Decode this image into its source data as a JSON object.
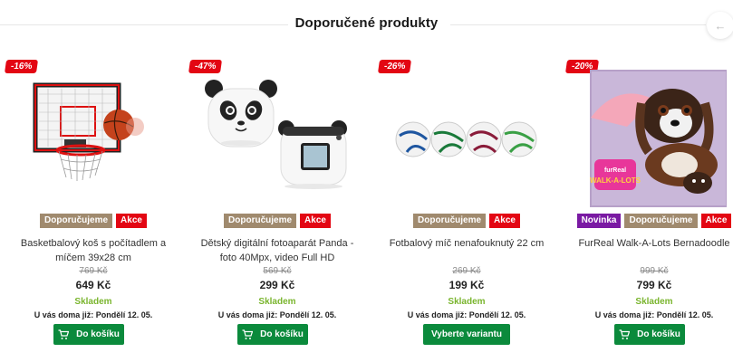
{
  "section": {
    "title": "Doporučené produkty",
    "nav_prev_icon": "arrow-left-icon"
  },
  "colors": {
    "discount": "#e30613",
    "recommended": "#a08a6e",
    "sale": "#e30613",
    "new": "#7a1aa3",
    "stock": "#7ab52e",
    "cart_button": "#0b8a3c"
  },
  "products": [
    {
      "discount": "-16%",
      "badges": {
        "recommended": "Doporučujeme",
        "sale": "Akce"
      },
      "name": "Basketbalový koš s počítadlem a míčem 39x28 cm",
      "old_price": "769 Kč",
      "price": "649 Kč",
      "stock": "Skladem",
      "delivery": "U vás doma již: Pondělí 12. 05.",
      "button": "Do košíku"
    },
    {
      "discount": "-47%",
      "badges": {
        "recommended": "Doporučujeme",
        "sale": "Akce"
      },
      "name": "Dětský digitální fotoaparát Panda - foto 40Mpx, video Full HD",
      "old_price": "569 Kč",
      "price": "299 Kč",
      "stock": "Skladem",
      "delivery": "U vás doma již: Pondělí 12. 05.",
      "button": "Do košíku"
    },
    {
      "discount": "-26%",
      "badges": {
        "recommended": "Doporučujeme",
        "sale": "Akce"
      },
      "name": "Fotbalový míč nenafouknutý 22 cm",
      "old_price": "269 Kč",
      "price": "199 Kč",
      "stock": "Skladem",
      "delivery": "U vás doma již: Pondělí 12. 05.",
      "button": "Vyberte variantu"
    },
    {
      "discount": "-20%",
      "badges": {
        "new": "Novinka",
        "recommended": "Doporučujeme",
        "sale": "Akce"
      },
      "name": "FurReal Walk-A-Lots Bernadoodle",
      "old_price": "999 Kč",
      "price": "799 Kč",
      "stock": "Skladem",
      "delivery": "U vás doma již: Pondělí 12. 05.",
      "button": "Do košíku",
      "image_logo_text": "Walk-A-Lots"
    }
  ]
}
